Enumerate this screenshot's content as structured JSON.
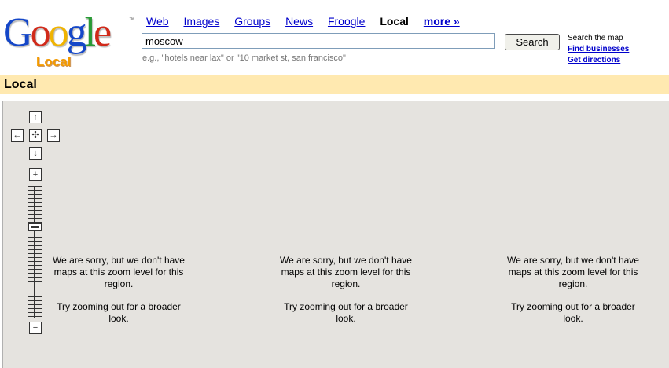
{
  "logo": {
    "letters": [
      {
        "char": "G",
        "color": "#1547c8"
      },
      {
        "char": "o",
        "color": "#d12a1a"
      },
      {
        "char": "o",
        "color": "#f0b300"
      },
      {
        "char": "g",
        "color": "#1547c8"
      },
      {
        "char": "l",
        "color": "#2a9a36"
      },
      {
        "char": "e",
        "color": "#d12a1a"
      }
    ],
    "sub": "Local",
    "tm": "™"
  },
  "nav": {
    "web": "Web",
    "images": "Images",
    "groups": "Groups",
    "news": "News",
    "froogle": "Froogle",
    "local": "Local",
    "more": "more »"
  },
  "search": {
    "value": "moscow",
    "button": "Search",
    "hint": "e.g., \"hotels near lax\" or \"10 market st, san francisco\""
  },
  "side": {
    "label": "Search the map",
    "find": "Find businesses",
    "directions": "Get directions"
  },
  "section": {
    "title": "Local"
  },
  "map_controls": {
    "pan_up": "↑",
    "pan_left": "←",
    "center": "✣",
    "pan_right": "→",
    "pan_down": "↓",
    "zoom_in": "+",
    "zoom_out": "−"
  },
  "tiles": [
    {
      "sorry": "We are sorry, but we don't have maps at this zoom level for this region.",
      "advice": "Try zooming out for a broader look."
    },
    {
      "sorry": "We are sorry, but we don't have maps at this zoom level for this region.",
      "advice": "Try zooming out for a broader look."
    },
    {
      "sorry": "We are sorry, but we don't have maps at this zoom level for this region.",
      "advice": "Try zooming out for a broader look."
    }
  ]
}
